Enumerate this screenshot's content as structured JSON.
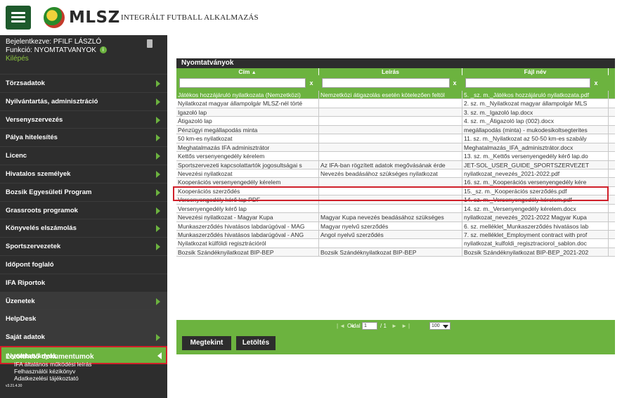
{
  "header": {
    "logo_text": "MLSZ",
    "app_title": "INTEGRÁLT FUTBALL ALKALMAZÁS"
  },
  "user": {
    "login_line": "Bejelentkezve: PFILF LÁSZLÓ",
    "function_line": "Funkció: NYOMTATVANYOK",
    "info_symbol": "i",
    "logout": "Kilépés"
  },
  "sidebar": {
    "items": [
      {
        "label": "Törzsadatok",
        "arrow": true
      },
      {
        "label": "Nyilvántartás, adminisztráció",
        "arrow": true
      },
      {
        "label": "Versenyszervezés",
        "arrow": true
      },
      {
        "label": "Pálya hitelesítés",
        "arrow": true
      },
      {
        "label": "Licenc",
        "arrow": true
      },
      {
        "label": "Hivatalos személyek",
        "arrow": true
      },
      {
        "label": "Bozsik Egyesületi Program",
        "arrow": true
      },
      {
        "label": "Grassroots programok",
        "arrow": true
      },
      {
        "label": "Könyvelés elszámolás",
        "arrow": true
      },
      {
        "label": "Sportszervezetek",
        "arrow": true
      },
      {
        "label": "Időpont foglaló",
        "arrow": false
      },
      {
        "label": "IFA Riportok",
        "arrow": false
      },
      {
        "label": "Üzenetek",
        "arrow": true
      },
      {
        "label": "HelpDesk",
        "arrow": false
      },
      {
        "label": "Saját adatok",
        "arrow": true
      },
      {
        "label": "Nyomtatványok",
        "arrow": false,
        "active": true
      }
    ],
    "docs_title": "Letölthető dokumentumok",
    "docs": [
      "IFA általános működési leírás",
      "Felhasználói kézikönyv",
      "Adatkezelési tájékoztató"
    ],
    "version": "v3.21.4.30"
  },
  "grid": {
    "title": "Nyomtatványok",
    "columns": [
      "Cím",
      "Leírás",
      "Fájl név"
    ],
    "sort_symbol": "▲",
    "filter_clear": "x",
    "rows": [
      [
        "Játékos hozzájáruló nyilatkozata (Nemzetközi)",
        "Nemzetközi átigazolás esetén kötelezően feltöl",
        "5. _sz. m._Játékos hozzájáruló nyilatkozata.pdf"
      ],
      [
        "Nyilatkozat magyar állampolgár MLSZ-nél törté",
        "",
        "2. sz. m._Nyilatkozat magyar állampolgár MLS"
      ],
      [
        "Igazoló lap",
        "",
        "3. sz. m._Igazoló lap.docx"
      ],
      [
        "Átigazoló lap",
        "",
        "4. sz. m._Átigazoló lap (002).docx"
      ],
      [
        "Pénzügyi megállapodás minta",
        "",
        "megállapodás (minta) - mukodesikoltsegterites"
      ],
      [
        "50 km-es nyilatkozat",
        "",
        "11. sz. m._Nyilatkozat az 50-50 km-es szabály"
      ],
      [
        "Meghatalmazás IFA adminisztrátor",
        "",
        "Meghatalmazás_IFA_adminisztrátor.docx"
      ],
      [
        "Kettős versenyengedély kérelem",
        "",
        "13. sz. m._Kettős versenyengedély kérő lap.do"
      ],
      [
        "Sportszervezeti kapcsolattartók jogosultságai s",
        "Az IFA-ban rögzített adatok megővásának érde",
        "JET-SOL_USER_GUIDE_SPORTSZERVEZET"
      ],
      [
        "Nevezési nyilatkozat",
        "Nevezés beadásához szükséges nyilatkozat",
        "nyilatkozat_nevezés_2021-2022.pdf"
      ],
      [
        "Kooperációs versenyengedély kérelem",
        "",
        "16. sz. m._Kooperációs versenyengedély kére"
      ],
      [
        "Kooperációs szerződés",
        "",
        "15._sz. m._Kooperációs szerződés.pdf"
      ],
      [
        "Versenyengedély kérő lap PDF",
        "",
        "14. sz. m._Versenyengedély kérelem.pdf"
      ],
      [
        "Versenyengedély kérő lap",
        "",
        "14. sz. m._Versenyengedély kérelem.docx"
      ],
      [
        "Nevezési nyilatkozat - Magyar Kupa",
        "Magyar Kupa nevezés beadásához szükséges",
        "nyilatkozat_nevezés_2021-2022 Magyar Kupa"
      ],
      [
        "Munkaszerződés hivatásos labdarúgóval - MAG",
        "Magyar nyelvű szerződés",
        "6. sz. melléklet_Munkaszerződés hivatásos lab"
      ],
      [
        "Munkaszerződés hivatásos labdarúgóval - ANG",
        "Angol nyelvű szerződés",
        "7. sz. melléklet_Employment contract with prof"
      ],
      [
        "Nyilatkozat külföldi regisztrációról",
        "",
        "nyilatkozat_kulfoldi_regisztraciorol_sablon.doc"
      ],
      [
        "Bozsik Szándéknyilatkozat BIP-BEP",
        "Bozsik Szándéknyilatkozat BIP-BEP",
        "Bozsik Szándéknyilatkozat BIP-BEP_2021-202"
      ]
    ]
  },
  "pager": {
    "first_prev": "|◄ ◄",
    "page_label": "Oldal",
    "page_value": "1",
    "total": "/ 1",
    "next_last": "► ►|",
    "page_size": "100"
  },
  "buttons": {
    "view": "Megtekint",
    "download": "Letöltés"
  },
  "colors": {
    "accent_green": "#6cb33f",
    "dark": "#2d2d2d",
    "highlight_red": "#d0202a"
  }
}
